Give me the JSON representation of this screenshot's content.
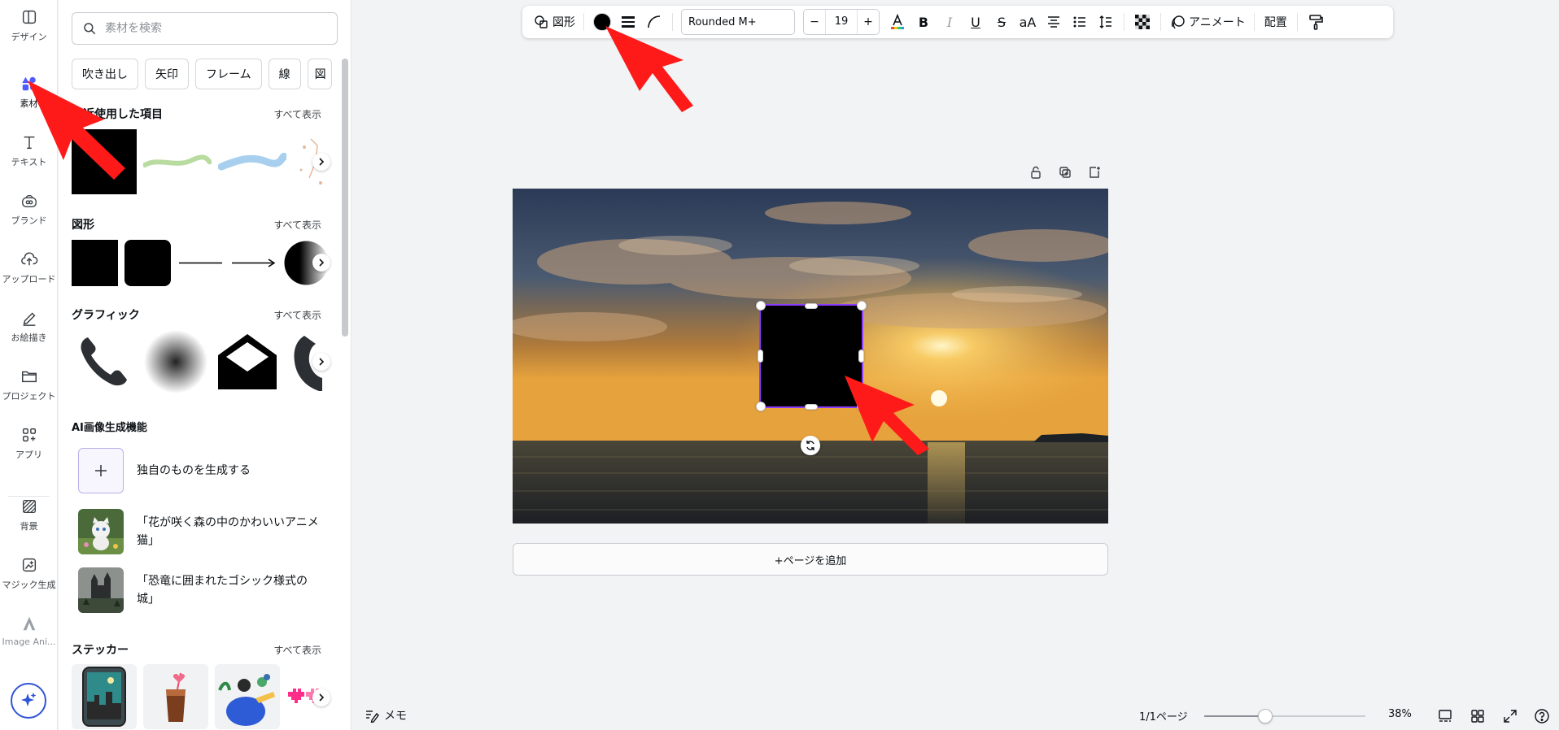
{
  "rail": {
    "items": [
      {
        "label": "デザイン",
        "icon": "layout-icon"
      },
      {
        "label": "素材",
        "icon": "elements-icon"
      },
      {
        "label": "テキスト",
        "icon": "text-icon"
      },
      {
        "label": "ブランド",
        "icon": "brand-icon"
      },
      {
        "label": "アップロード",
        "icon": "upload-icon"
      },
      {
        "label": "お絵描き",
        "icon": "draw-icon"
      },
      {
        "label": "プロジェクト",
        "icon": "folder-icon"
      },
      {
        "label": "アプリ",
        "icon": "apps-icon"
      },
      {
        "label": "背景",
        "icon": "background-icon"
      },
      {
        "label": "マジック生成",
        "icon": "magic-media-icon"
      },
      {
        "label": "Image Ani...",
        "icon": "image-animate-icon"
      }
    ]
  },
  "panel": {
    "search_placeholder": "素材を検索",
    "chips": [
      "吹き出し",
      "矢印",
      "フレーム",
      "線",
      "図"
    ],
    "recent": {
      "title": "最近使用した項目",
      "see_all": "すべて表示"
    },
    "shapes": {
      "title": "図形",
      "see_all": "すべて表示"
    },
    "graphics": {
      "title": "グラフィック",
      "see_all": "すべて表示"
    },
    "ai": {
      "title": "AI画像生成機能",
      "create_label": "独自のものを生成する",
      "items": [
        "「花が咲く森の中のかわいいアニメ猫」",
        "「恐竜に囲まれたゴシック様式の城」"
      ]
    },
    "stickers": {
      "title": "ステッカー",
      "see_all": "すべて表示"
    }
  },
  "toolbar": {
    "shape_label": "図形",
    "fill_color": "#000000",
    "font": "Rounded M+",
    "size": "19",
    "size_minus": "−",
    "size_plus": "+",
    "bold": "B",
    "italic": "I",
    "underline": "U",
    "strike": "S",
    "case": "aA",
    "animate": "アニメート",
    "position": "配置"
  },
  "canvas": {
    "add_page": "+ページを追加",
    "shape_fill": "#000000",
    "selection_color": "#8b3dff"
  },
  "bottom": {
    "memo": "メモ",
    "pages": "1/1ページ",
    "zoom": "38%",
    "zoom_fraction": 0.38
  },
  "colors": {
    "accent": "#8b3dff",
    "annotation": "#ff1a1a"
  }
}
